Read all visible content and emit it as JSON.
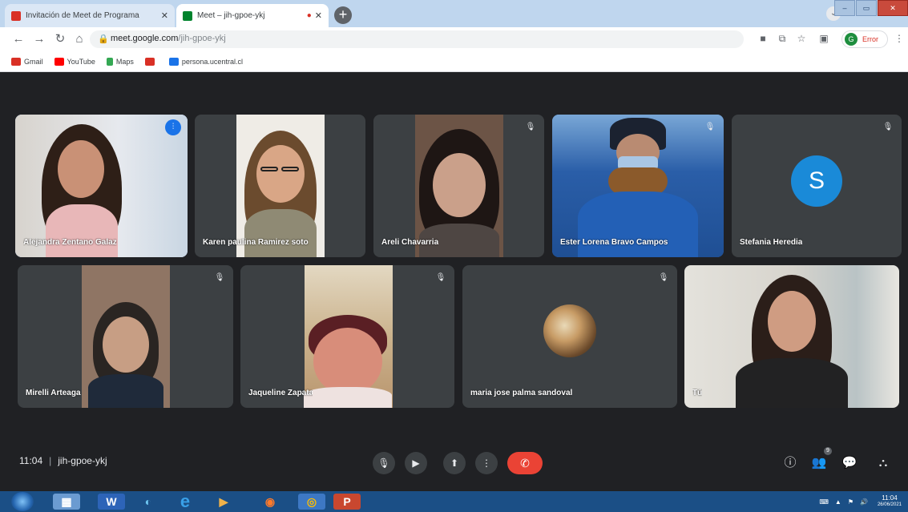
{
  "browser": {
    "tabs": [
      {
        "label": "Invitación de Meet de Programa"
      },
      {
        "label": "Meet – jih-gpoe-ykj"
      }
    ],
    "url_host": "meet.google.com",
    "url_path": "/jih-gpoe-ykj",
    "profile_status": "Error",
    "profile_initial": "G",
    "bookmarks": [
      {
        "label": "Gmail",
        "color": "#d93025"
      },
      {
        "label": "YouTube",
        "color": "#ff0000"
      },
      {
        "label": "Maps",
        "color": "#34a853"
      },
      {
        "label": "",
        "color": "#d93025"
      },
      {
        "label": "persona.ucentral.cl",
        "color": "#1a73e8"
      }
    ]
  },
  "meet": {
    "participants": [
      {
        "name": "Alejandra Zentano Galaz",
        "state": "speaking"
      },
      {
        "name": "Karen paulina Ramirez soto",
        "state": "video"
      },
      {
        "name": "Areli Chavarria",
        "state": "muted"
      },
      {
        "name": "Ester Lorena Bravo Campos",
        "state": "muted"
      },
      {
        "name": "Stefania Heredia",
        "state": "muted",
        "avatar_letter": "S",
        "avatar_color": "#1a8ad8"
      },
      {
        "name": "Mirelli Arteaga",
        "state": "muted"
      },
      {
        "name": "Jaqueline Zapata",
        "state": "muted"
      },
      {
        "name": "maria jose palma sandoval",
        "state": "muted"
      },
      {
        "name": "Tú",
        "state": "video"
      }
    ],
    "time": "11:04",
    "meeting_code": "jih-gpoe-ykj",
    "participant_count": "9",
    "accent": "#8ab4f8",
    "hangup_color": "#ea4335"
  },
  "taskbar": {
    "clock_time": "11:04",
    "clock_date": "26/06/2021"
  }
}
